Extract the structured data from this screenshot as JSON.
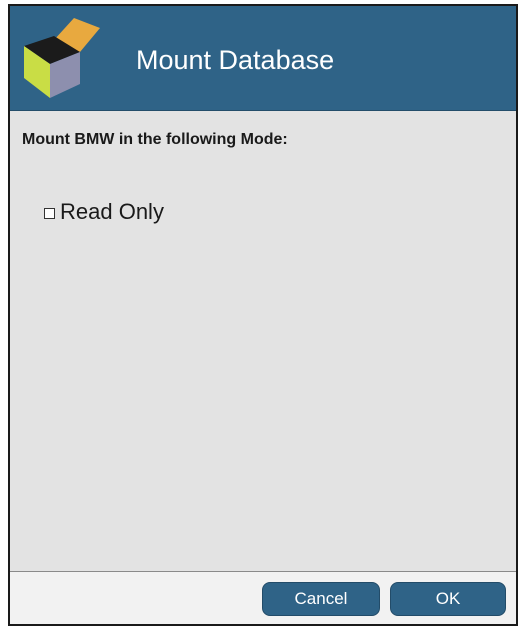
{
  "dialog": {
    "title": "Mount Database",
    "icon": "cube-icon",
    "accent_color": "#2f6387",
    "body_background": "#e3e3e3"
  },
  "main": {
    "prompt": "Mount BMW in the following Mode:",
    "options": [
      {
        "label": "Read Only",
        "checked": false
      }
    ]
  },
  "footer": {
    "cancel_label": "Cancel",
    "ok_label": "OK"
  }
}
